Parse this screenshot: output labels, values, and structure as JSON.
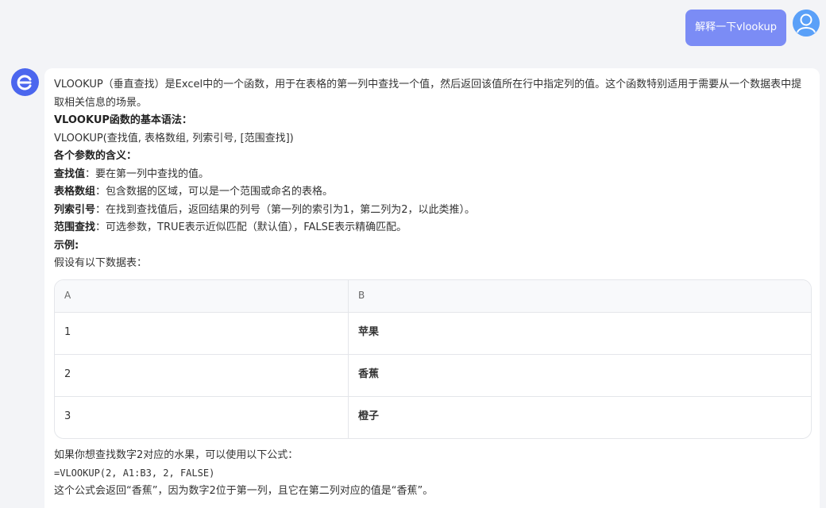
{
  "user_message": {
    "text": "解释一下vlookup"
  },
  "assistant": {
    "intro": "VLOOKUP（垂直查找）是Excel中的一个函数，用于在表格的第一列中查找一个值，然后返回该值所在行中指定列的值。这个函数特别适用于需要从一个数据表中提取相关信息的场景。",
    "syntax_heading": "VLOOKUP函数的基本语法：",
    "syntax": "VLOOKUP(查找值, 表格数组, 列索引号, [范围查找])",
    "params_heading": "各个参数的含义：",
    "params": [
      {
        "term": "查找值",
        "desc": "：要在第一列中查找的值。"
      },
      {
        "term": "表格数组",
        "desc": "：包含数据的区域，可以是一个范围或命名的表格。"
      },
      {
        "term": "列索引号",
        "desc": "：在找到查找值后，返回结果的列号（第一列的索引为1，第二列为2，以此类推）。"
      },
      {
        "term": "范围查找",
        "desc": "：可选参数，TRUE表示近似匹配（默认值），FALSE表示精确匹配。"
      }
    ],
    "example_heading": "示例:",
    "example_intro": "假设有以下数据表：",
    "table": {
      "headers": [
        "A",
        "B"
      ],
      "rows": [
        [
          "1",
          "苹果"
        ],
        [
          "2",
          "香蕉"
        ],
        [
          "3",
          "橙子"
        ]
      ]
    },
    "formula_intro": "如果你想查找数字2对应的水果，可以使用以下公式：",
    "formula": "=VLOOKUP(2, A1:B3, 2, FALSE)",
    "conclusion": "这个公式会返回“香蕉”，因为数字2位于第一列，且它在第二列对应的值是“香蕉”。"
  },
  "colors": {
    "user_bubble": "#7b8cf5",
    "bot_avatar": "#4b66ee",
    "background": "#f3f4f7"
  }
}
